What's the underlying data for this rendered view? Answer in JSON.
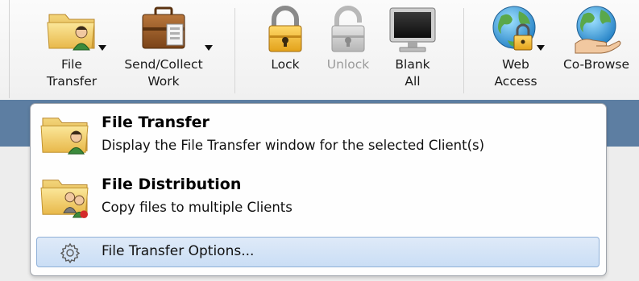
{
  "toolbar": {
    "items": [
      {
        "name": "file-transfer",
        "label": "File\nTransfer",
        "icon": "folder-user-icon",
        "enabled": true,
        "has_dropdown": true
      },
      {
        "name": "send-collect-work",
        "label": "Send/Collect\nWork",
        "icon": "briefcase-icon",
        "enabled": true,
        "has_dropdown": true
      },
      {
        "name": "lock",
        "label": "Lock",
        "icon": "lock-icon",
        "enabled": true,
        "has_dropdown": false
      },
      {
        "name": "unlock",
        "label": "Unlock",
        "icon": "unlock-icon",
        "enabled": false,
        "has_dropdown": false
      },
      {
        "name": "blank-all",
        "label": "Blank\nAll",
        "icon": "monitor-icon",
        "enabled": true,
        "has_dropdown": false
      },
      {
        "name": "web-access",
        "label": "Web\nAccess",
        "icon": "globe-lock-icon",
        "enabled": true,
        "has_dropdown": true
      },
      {
        "name": "co-browse",
        "label": "Co-Browse",
        "icon": "globe-hand-icon",
        "enabled": true,
        "has_dropdown": false
      }
    ]
  },
  "menu": {
    "items": [
      {
        "title": "File Transfer",
        "description": "Display the File Transfer window for the selected Client(s)",
        "icon": "folder-user-icon"
      },
      {
        "title": "File Distribution",
        "description": "Copy files to multiple Clients",
        "icon": "folder-users-icon"
      }
    ],
    "option": {
      "label": "File Transfer Options...",
      "icon": "gear-icon"
    }
  },
  "colors": {
    "accent_bar": "#5d7ea2",
    "menu_highlight": "#cadef5",
    "disabled_text": "#9a9a9a"
  }
}
